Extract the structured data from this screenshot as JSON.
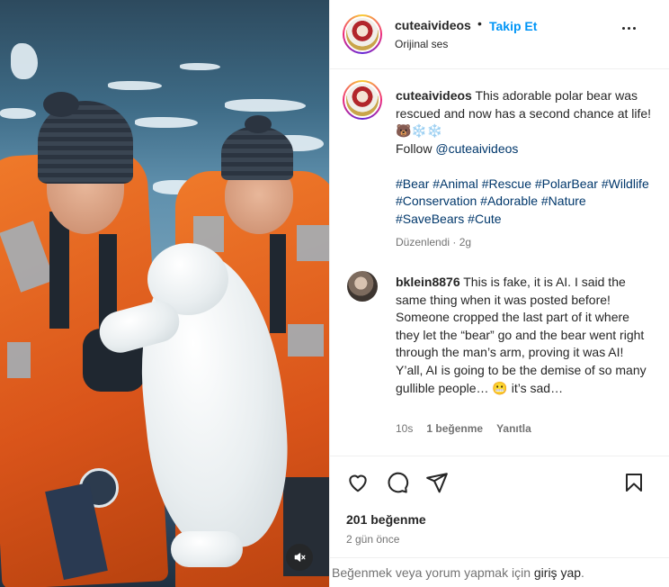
{
  "header": {
    "username": "cuteaivideos",
    "separator": "•",
    "follow_label": "Takip Et",
    "audio_label": "Orijinal ses"
  },
  "caption": {
    "username": "cuteaivideos",
    "text": "This adorable polar bear was rescued and now has a second chance at life!",
    "emojis": "🐻❄️❄️",
    "follow_prefix": "Follow",
    "follow_handle": "@cuteaivideos",
    "hashtags": [
      "#Bear",
      "#Animal",
      "#Rescue",
      "#PolarBear",
      "#Wildlife",
      "#Conservation",
      "#Adorable",
      "#Nature",
      "#SaveBears",
      "#Cute"
    ],
    "edited_label": "Düzenlendi",
    "meta_sep": "·",
    "time": "2g"
  },
  "comment": {
    "username": "bklein8876",
    "text": "This is fake, it is AI. I said the same thing when it was posted before! Someone cropped the last part of it where they let the “bear” go and the bear went right through the man’s arm, proving it was AI! Y’all, AI is going to be the demise of so many gullible people…",
    "emoji": "😬",
    "tail": "it’s sad…",
    "time": "10s",
    "likes": "1 beğenme",
    "reply_label": "Yanıtla"
  },
  "post": {
    "like_count": "201 beğenme",
    "posted_ago": "2 gün önce"
  },
  "footer": {
    "prefix": "Beğenmek veya yorum yapmak için",
    "login_label": "giriş yap",
    "suffix": "."
  },
  "icons": {
    "like": "heart-icon",
    "comment": "comment-icon",
    "share": "share-icon",
    "save": "bookmark-icon",
    "more": "more-horizontal-icon",
    "mute": "speaker-muted-icon"
  },
  "colors": {
    "accent": "#0095f6",
    "link": "#00376b",
    "muted": "#737373",
    "text": "#262626"
  }
}
